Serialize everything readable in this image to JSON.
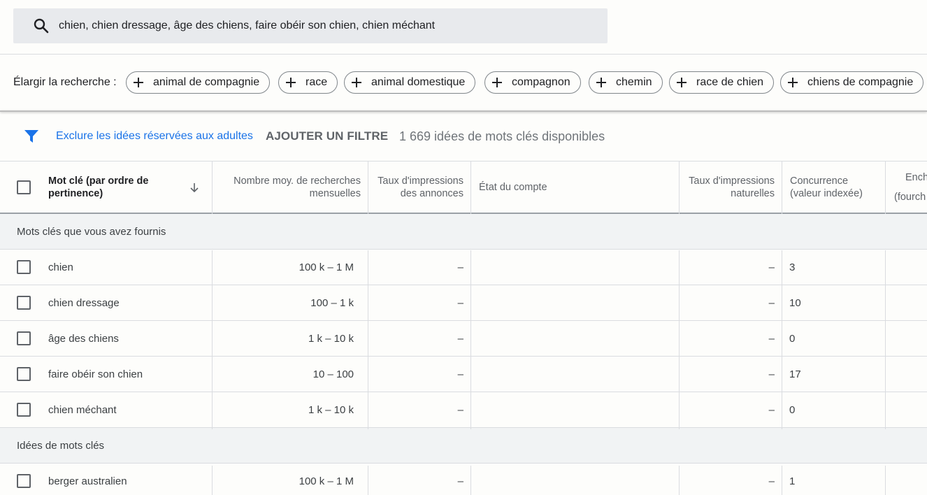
{
  "search": {
    "query": "chien, chien dressage, âge des chiens, faire obéir son chien, chien méchant",
    "icon": "search-icon"
  },
  "broaden": {
    "label": "Élargir la recherche :",
    "chips": [
      "animal de compagnie",
      "race",
      "animal domestique",
      "compagnon",
      "chemin",
      "race de chien",
      "chiens de compagnie"
    ]
  },
  "filters": {
    "exclude_adult": "Exclure les idées réservées aux adultes",
    "add_filter": "AJOUTER UN FILTRE",
    "count": "1 669 idées de mots clés disponibles",
    "accent_color": "#1a73e8"
  },
  "table": {
    "headers": {
      "keyword": "Mot clé (par ordre de pertinence)",
      "avg_searches": "Nombre moy. de recherches mensuelles",
      "ad_impressions": "Taux d'impressions des annonces",
      "account_status": "État du compte",
      "organic_impressions": "Taux d'impressions naturelles",
      "competition": "Concurrence (valeur indexée)",
      "bid_line1": "Ench",
      "bid_line2": "(fourch"
    },
    "group_provided": "Mots clés que vous avez fournis",
    "group_ideas": "Idées de mots clés",
    "provided_rows": [
      {
        "keyword": "chien",
        "avg": "100 k – 1 M",
        "ad": "–",
        "status": "",
        "organic": "–",
        "competition": "3"
      },
      {
        "keyword": "chien dressage",
        "avg": "100 – 1 k",
        "ad": "–",
        "status": "",
        "organic": "–",
        "competition": "10"
      },
      {
        "keyword": "âge des chiens",
        "avg": "1 k – 10 k",
        "ad": "–",
        "status": "",
        "organic": "–",
        "competition": "0"
      },
      {
        "keyword": "faire obéir son chien",
        "avg": "10 – 100",
        "ad": "–",
        "status": "",
        "organic": "–",
        "competition": "17"
      },
      {
        "keyword": "chien méchant",
        "avg": "1 k – 10 k",
        "ad": "–",
        "status": "",
        "organic": "–",
        "competition": "0"
      }
    ],
    "idea_rows": [
      {
        "keyword": "berger australien",
        "avg": "100 k – 1 M",
        "ad": "–",
        "status": "",
        "organic": "–",
        "competition": "1"
      }
    ]
  }
}
